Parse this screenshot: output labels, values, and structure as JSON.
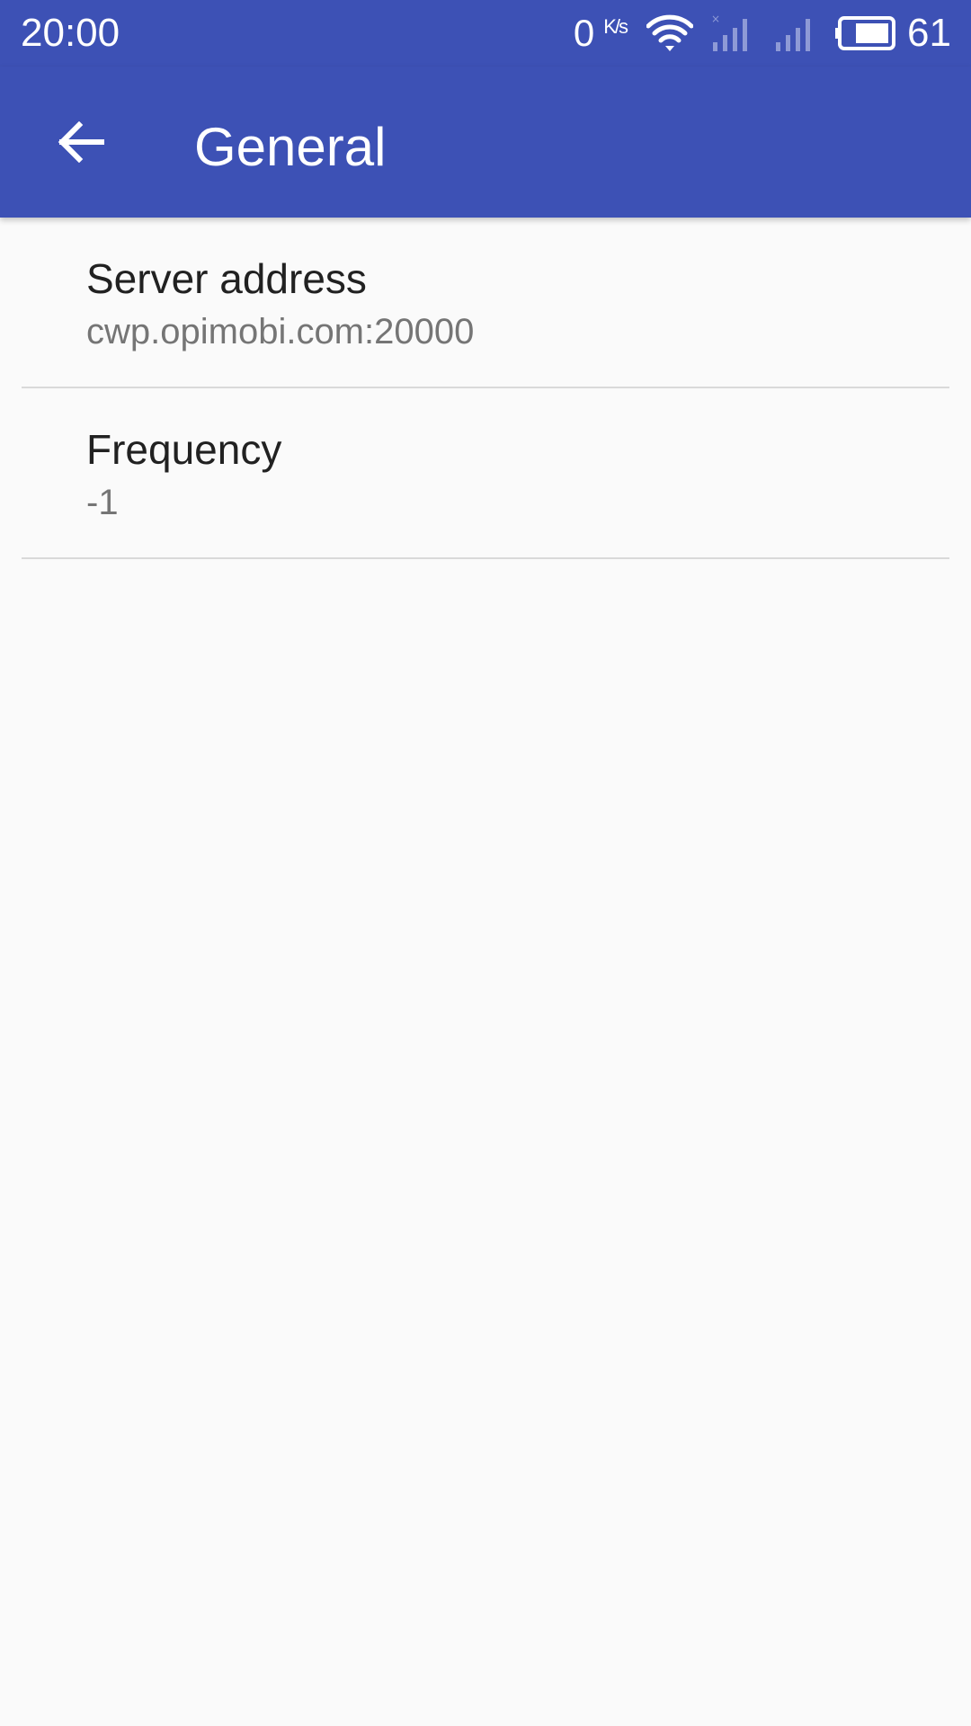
{
  "status_bar": {
    "time": "20:00",
    "net_speed_value": "0",
    "net_speed_unit": "K/s",
    "battery_level": "61",
    "icons": [
      "wifi-icon",
      "signal-icon",
      "signal-icon",
      "battery-icon"
    ]
  },
  "toolbar": {
    "title": "General",
    "back_icon": "arrow-back-icon"
  },
  "preferences": [
    {
      "title": "Server address",
      "summary": "cwp.opimobi.com:20000"
    },
    {
      "title": "Frequency",
      "summary": "-1"
    }
  ],
  "colors": {
    "primary": "#3d51b5",
    "background": "#fafafa",
    "title_text": "#212121",
    "summary_text": "#757575",
    "divider": "#d9d9d9"
  }
}
